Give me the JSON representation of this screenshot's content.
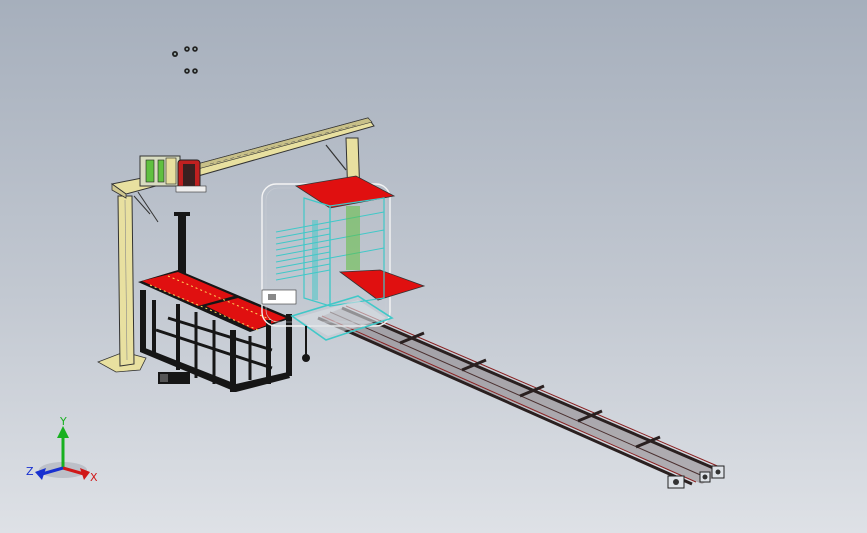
{
  "viewport": {
    "background_top": "#a6afbc",
    "background_bottom": "#dee1e6"
  },
  "triad": {
    "x_label": "X",
    "y_label": "Y",
    "z_label": "Z",
    "x_color": "#d01818",
    "y_color": "#18b020",
    "z_color": "#1830d0"
  },
  "model": {
    "colors": {
      "frame_dark": "#161616",
      "frame_yellow": "#e8e0a0",
      "conveyor_red": "#e01010",
      "cyan_outline": "#40c8c8",
      "rail_dark": "#2a2020",
      "rail_red": "#8a2020",
      "accent_green": "#60c040",
      "gripper_red": "#c02020"
    }
  }
}
